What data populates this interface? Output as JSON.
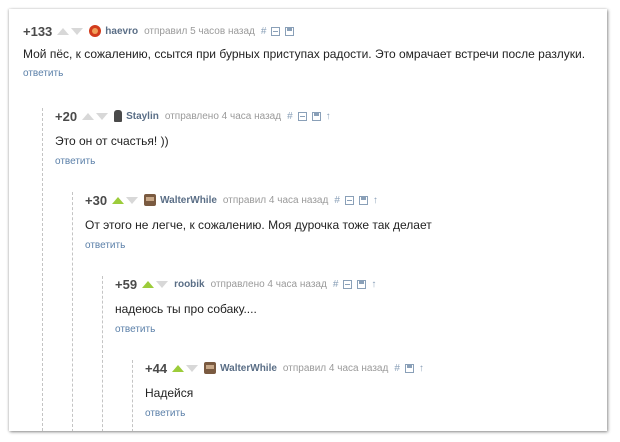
{
  "comments": [
    {
      "rating": "+133",
      "author": "haevro",
      "meta": "отправил 5 часов назад",
      "text": "Мой пёс, к сожалению, ссытся при бурных приступах радости. Это омрачает встречи после разлуки.",
      "reply": "ответить",
      "upvoted": false,
      "avatar": "haevro-avatar"
    },
    {
      "rating": "+20",
      "author": "Staylin",
      "meta": "отправлено 4 часа назад",
      "text": "Это он от счастья! ))",
      "reply": "ответить",
      "upvoted": false,
      "avatar": "staylin-avatar"
    },
    {
      "rating": "+30",
      "author": "WalterWhile",
      "meta": "отправил 4 часа назад",
      "text": "От этого не легче, к сожалению. Моя дурочка тоже так делает",
      "reply": "ответить",
      "upvoted": true,
      "avatar": "walterwhile-avatar"
    },
    {
      "rating": "+59",
      "author": "roobik",
      "meta": "отправлено 4 часа назад",
      "text": "надеюсь ты про собаку....",
      "reply": "ответить",
      "upvoted": true,
      "avatar": ""
    },
    {
      "rating": "+44",
      "author": "WalterWhile",
      "meta": "отправил 4 часа назад",
      "text": "Надейся",
      "reply": "ответить",
      "upvoted": true,
      "avatar": "walterwhile-avatar"
    }
  ],
  "icons": {
    "link": "#",
    "upvote": "upvote-arrow-icon",
    "downvote": "downvote-arrow-icon",
    "collapse": "collapse-icon",
    "save": "save-icon",
    "parent": "↑"
  },
  "colors": {
    "upvote_active": "#9ccc3a",
    "author": "#5a6e86",
    "reply_link": "#5a7fa8"
  }
}
